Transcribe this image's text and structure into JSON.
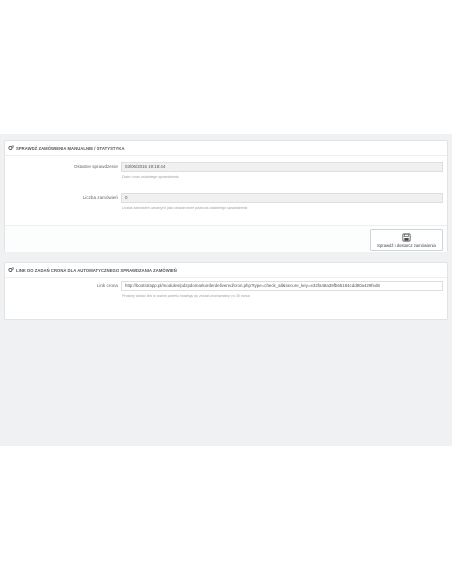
{
  "stats_panel": {
    "heading": "Sprawdź zamówienia manualnie / Statystyka",
    "last_check_label": "Ostatnie sprawdzenie",
    "last_check_value": "03/06/2016 19:18:44",
    "last_check_help": "Data i czas ostatniego sprawdzenia",
    "orders_count_label": "Liczba zamówień",
    "orders_count_value": "0",
    "orders_count_help": "Liczba zamówień uznanych jako dostarczone podczas ostatniego sprawdzenia",
    "save_button_label": "Sprawdź i dostarcz zamówienia",
    "save_icon": "floppy-disk-icon"
  },
  "cron_panel": {
    "heading": "Link do zadań crona dla automatycznego sprawdzania zamówień",
    "cron_link_label": "Link crona",
    "cron_link_value": "http://bootstrapp.pl/modules/pdzpdomarkorderdelivered/cron.php?type=check_all&secure_key=e32fa48a39fb65184cdd80a429fed8",
    "cron_link_help": "Prosimy dodać link w swoim panelu hostingu by został uruchamiany co 30 minut."
  },
  "colors": {
    "background_area": "#eff1f2",
    "panel_border": "#e1e4e6",
    "field_disabled": "#f0f0f0"
  }
}
